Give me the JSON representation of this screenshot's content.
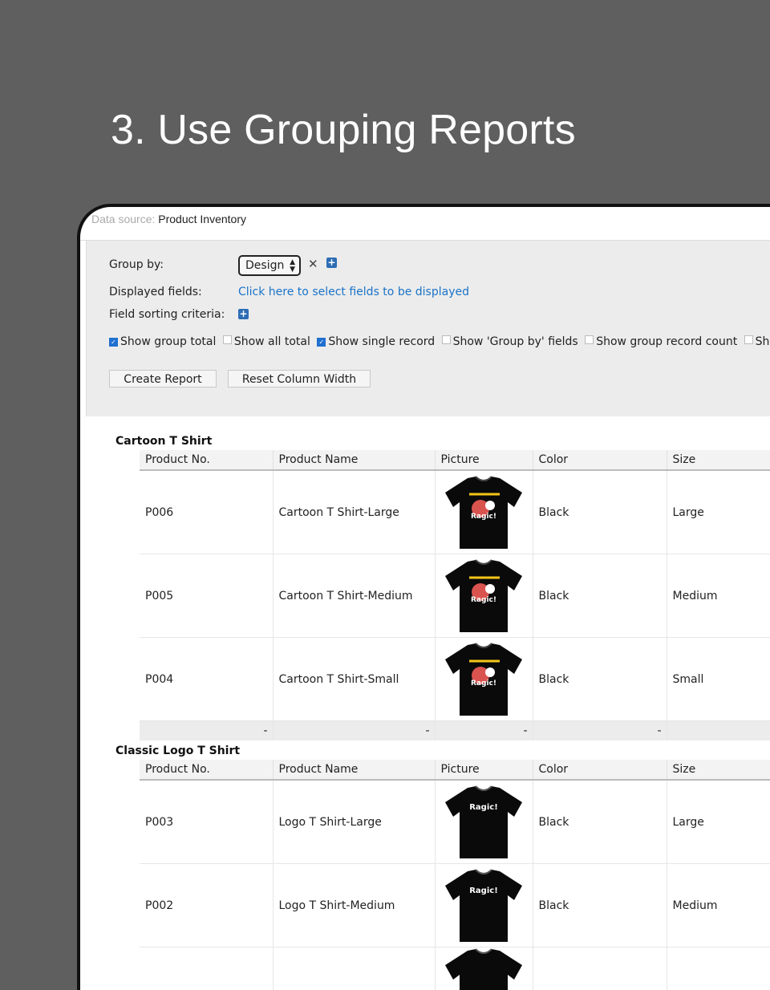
{
  "slide_title": "3. Use Grouping Reports",
  "data_source": {
    "label": "Data source:",
    "value": "Product Inventory"
  },
  "controls": {
    "group_by_label": "Group by:",
    "group_by_value": "Design",
    "displayed_fields_label": "Displayed fields:",
    "displayed_fields_link": "Click here to select fields to be displayed",
    "sorting_label": "Field sorting criteria:",
    "options": [
      {
        "label": "Show group total",
        "checked": true
      },
      {
        "label": "Show all total",
        "checked": false
      },
      {
        "label": "Show single record",
        "checked": true
      },
      {
        "label": "Show 'Group by' fields",
        "checked": false
      },
      {
        "label": "Show group record count",
        "checked": false
      },
      {
        "label": "Show",
        "checked": false
      }
    ],
    "create_report": "Create Report",
    "reset_width": "Reset Column Width"
  },
  "columns": [
    "Product No.",
    "Product Name",
    "Picture",
    "Color",
    "Size"
  ],
  "groups": [
    {
      "title": "Cartoon T Shirt",
      "rows": [
        {
          "no": "P006",
          "name": "Cartoon T Shirt-Large",
          "picture_text": "Ragic!",
          "color": "Black",
          "size": "Large"
        },
        {
          "no": "P005",
          "name": "Cartoon T Shirt-Medium",
          "picture_text": "Ragic!",
          "color": "Black",
          "size": "Medium"
        },
        {
          "no": "P004",
          "name": "Cartoon T Shirt-Small",
          "picture_text": "Ragic!",
          "color": "Black",
          "size": "Small"
        }
      ],
      "totals": [
        "-",
        "-",
        "-",
        "-"
      ]
    },
    {
      "title": "Classic Logo T Shirt",
      "rows": [
        {
          "no": "P003",
          "name": "Logo T Shirt-Large",
          "picture_text": "Ragic!",
          "color": "Black",
          "size": "Large"
        },
        {
          "no": "P002",
          "name": "Logo T Shirt-Medium",
          "picture_text": "Ragic!",
          "color": "Black",
          "size": "Medium"
        },
        {
          "no": "",
          "name": "",
          "picture_text": "",
          "color": "",
          "size": ""
        }
      ]
    }
  ]
}
